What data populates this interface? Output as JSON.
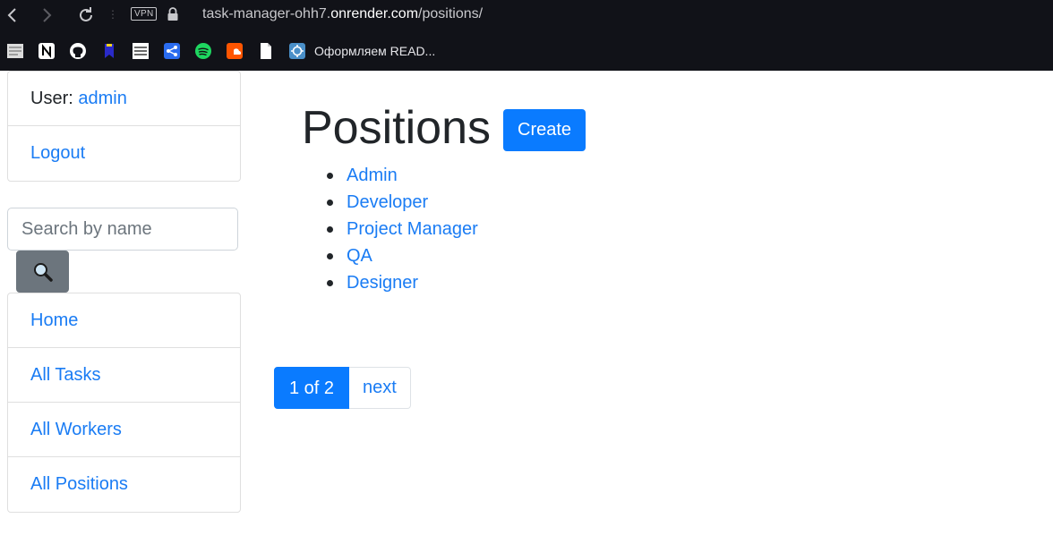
{
  "browser": {
    "vpn_label": "VPN",
    "url_prefix": "task-manager-ohh7.",
    "url_domain": "onrender.com",
    "url_path": "/positions/",
    "bookmark_text": "Оформляем READ...",
    "bookmarks": [
      "file-icon",
      "notion-icon",
      "github-icon",
      "bookmark-icon",
      "schedule-icon",
      "share-icon",
      "spotify-icon",
      "soundcloud-icon",
      "document-icon",
      "app-icon"
    ]
  },
  "user_panel": {
    "user_label": "User:",
    "username": "admin",
    "logout": "Logout"
  },
  "search": {
    "placeholder": "Search by name",
    "value": ""
  },
  "nav": {
    "items": [
      {
        "label": "Home"
      },
      {
        "label": "All Tasks"
      },
      {
        "label": "All Workers"
      },
      {
        "label": "All Positions"
      }
    ]
  },
  "main": {
    "title": "Positions",
    "create_label": "Create",
    "positions": [
      "Admin",
      "Developer",
      "Project Manager",
      "QA",
      "Designer"
    ]
  },
  "pagination": {
    "current": "1 of 2",
    "next": "next"
  },
  "colors": {
    "primary": "#0a7bff",
    "link": "#1a7cf4",
    "secondary": "#6c757d",
    "chrome_bg": "#111218"
  }
}
